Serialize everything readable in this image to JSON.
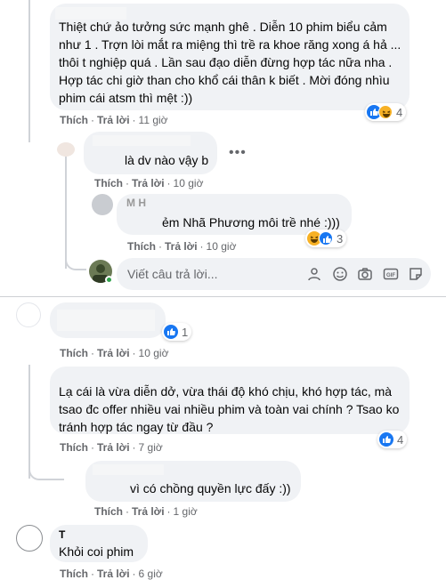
{
  "comments": [
    {
      "text_lines": [
        "Thiệt chứ ảo tưởng sức mạnh ghê . Diễn 10 phim biểu cảm",
        "như 1 . Trợn lòi mắt ra miệng thì trề ra khoe răng xong á hả ...",
        "thôi t nghiệp quá . Lần sau đạo diễn đừng hợp tác nữa nha .",
        "Hợp tác chi giờ than cho khổ cái thân k biết . Mời đóng nhìu",
        "phim cái atsm thì mệt :))"
      ],
      "like": "Thích",
      "reply": "Trả lời",
      "time": "11 giờ",
      "reactions": "4"
    },
    {
      "text": "là dv nào vậy b",
      "like": "Thích",
      "reply": "Trả lời",
      "time": "10 giờ"
    },
    {
      "author_fragment": "M    H",
      "text": "ẻm Nhã Phương môi trề nhé :)))",
      "like": "Thích",
      "reply": "Trả lời",
      "time": "10 giờ",
      "reactions": "3"
    },
    {
      "like": "Thích",
      "reply": "Trả lời",
      "time": "10 giờ",
      "reactions": "1"
    },
    {
      "text_lines": [
        "Lạ cái là vừa diễn dở, vừa thái độ khó chịu, khó hợp tác, mà",
        "tsao đc offer nhiều vai nhiều phim và toàn vai chính ? Tsao ko",
        "tránh hợp tác ngay từ đầu ?"
      ],
      "like": "Thích",
      "reply": "Trả lời",
      "time": "7 giờ",
      "reactions": "4"
    },
    {
      "text": "vì có chồng quyền lực đấy :))",
      "like": "Thích",
      "reply": "Trả lời",
      "time": "1 giờ"
    },
    {
      "author_fragment": "T",
      "text": "Khỏi coi phim",
      "like": "Thích",
      "reply": "Trả lời",
      "time": "6 giờ"
    }
  ],
  "reply_box": {
    "placeholder": "Viết câu trả lời..."
  },
  "more_options": "•••",
  "colors": {
    "bubble": "#f0f2f5",
    "meta": "#65676b",
    "like": "#1877f2",
    "haha": "#f7b125"
  },
  "icons": [
    "like-icon",
    "haha-icon",
    "wow-icon",
    "emoji-icon",
    "camera-icon",
    "gif-icon",
    "sticker-icon",
    "avatar-sticker-icon"
  ]
}
